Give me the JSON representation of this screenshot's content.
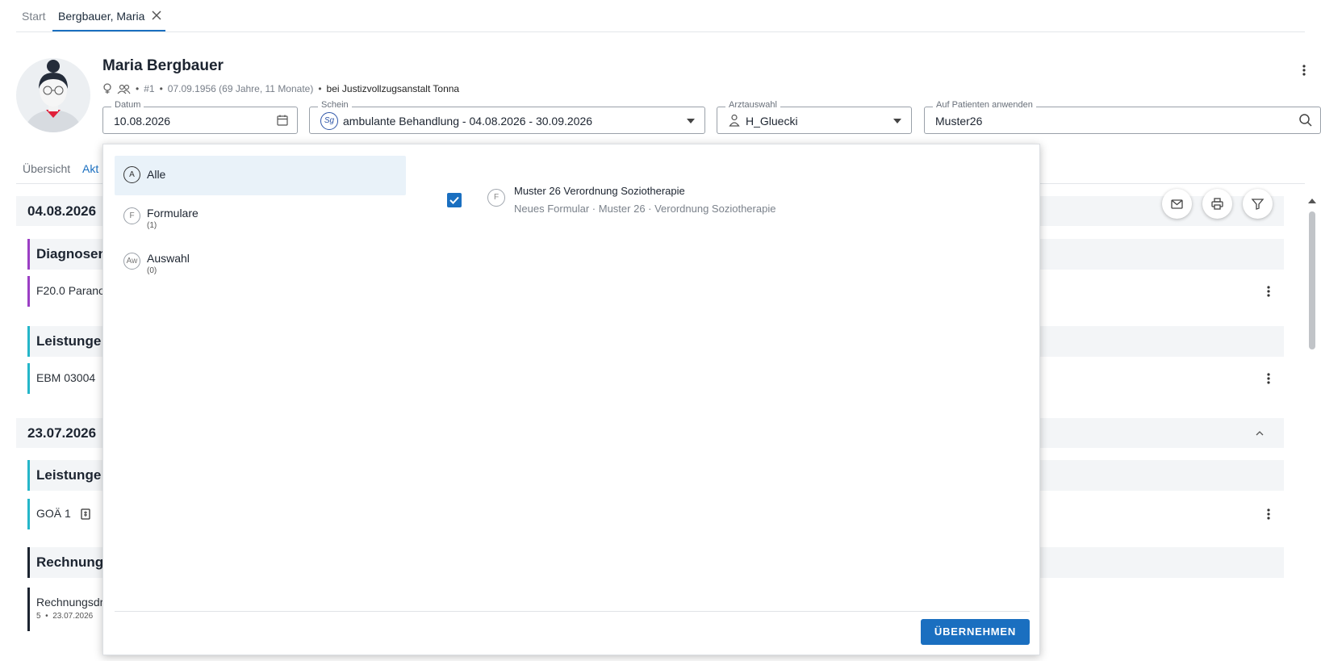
{
  "tabs": {
    "start": "Start",
    "patient": "Bergbauer, Maria"
  },
  "patient": {
    "name": "Maria Bergbauer",
    "number": "#1",
    "birth": "07.09.1956 (69 Jahre, 11 Monate)",
    "location": "bei Justizvollzugsanstalt Tonna"
  },
  "fields": {
    "datum": {
      "label": "Datum",
      "value": "10.08.2026"
    },
    "schein": {
      "label": "Schein",
      "badge": "Sg",
      "value": "ambulante Behandlung - 04.08.2026 - 30.09.2026"
    },
    "arzt": {
      "label": "Arztauswahl",
      "value": "H_Gluecki"
    },
    "apply": {
      "label": "Auf Patienten anwenden",
      "value": "Muster26"
    }
  },
  "content_tabs": {
    "overview": "Übersicht",
    "akt": "Akt"
  },
  "timeline": {
    "date1": "04.08.2026",
    "diagnosen": "Diagnosen",
    "diag_entry": "F20.0 Parano",
    "leistungen": "Leistunge",
    "ebm_entry": "EBM 03004",
    "date2": "23.07.2026",
    "leistungen2": "Leistunge",
    "goa_entry": "GOÄ 1",
    "rechnung": "Rechnung",
    "rechnung_entry": "Rechnungsdr",
    "rechnung_sub_num": "5",
    "rechnung_sub_date": "23.07.2026"
  },
  "popup": {
    "categories": [
      {
        "badge": "A",
        "label": "Alle",
        "count": ""
      },
      {
        "badge": "F",
        "label": "Formulare",
        "count": "(1)"
      },
      {
        "badge": "Aw",
        "label": "Auswahl",
        "count": "(0)"
      }
    ],
    "result": {
      "badge": "F",
      "title": "Muster 26 Verordnung Soziotherapie",
      "subtitle": "Neues Formular · Muster 26 · Verordnung Soziotherapie",
      "checked": true
    },
    "apply_button": "ÜBERNEHMEN"
  },
  "colors": {
    "accent": "#1a6fc0",
    "diag_accent": "#9b3fc4",
    "leist_accent": "#25b6c9",
    "rech_accent": "#1c2430"
  }
}
